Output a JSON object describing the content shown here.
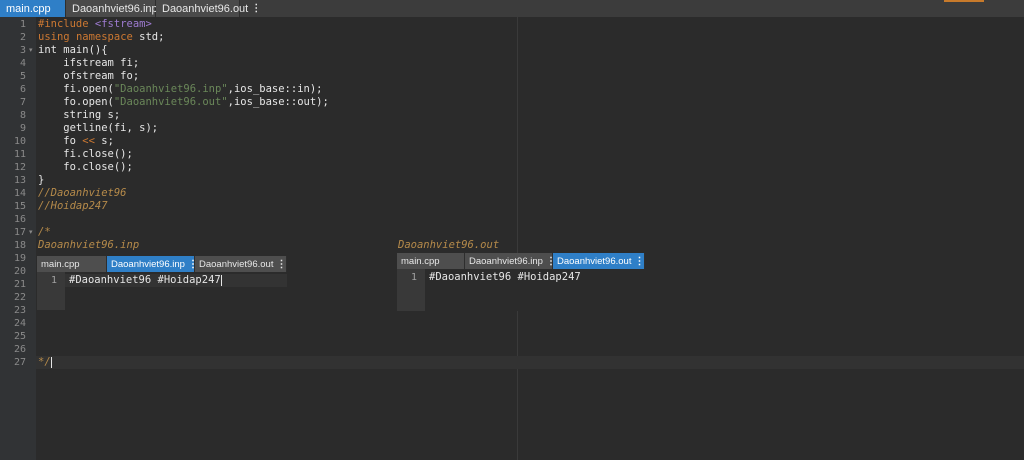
{
  "tabs": [
    {
      "label": "main.cpp",
      "active": true
    },
    {
      "label": "Daoanhviet96.inp",
      "active": false,
      "menu": "⋮"
    },
    {
      "label": "Daoanhviet96.out",
      "active": false,
      "menu": "⋮"
    }
  ],
  "line_numbers": [
    "1",
    "2",
    "3",
    "4",
    "5",
    "6",
    "7",
    "8",
    "9",
    "10",
    "11",
    "12",
    "13",
    "14",
    "15",
    "16",
    "17",
    "18",
    "19",
    "20",
    "21",
    "22",
    "23",
    "24",
    "25",
    "26",
    "27"
  ],
  "code": {
    "l1": {
      "kw": "#include",
      "str": "<fstream>"
    },
    "l2": {
      "kw1": "using",
      "kw2": "namespace",
      "rest": " std;"
    },
    "l3": "int main(){",
    "l4": "    ifstream fi;",
    "l5": "    ofstream fo;",
    "l6": {
      "pre": "    fi.open(",
      "str": "\"Daoanhviet96.inp\"",
      "post": ",ios_base::in);"
    },
    "l7": {
      "pre": "    fo.open(",
      "str": "\"Daoanhviet96.out\"",
      "post": ",ios_base::out);"
    },
    "l8": "    string s;",
    "l9": "    getline(fi, s);",
    "l10": {
      "pre": "    fo ",
      "op": "<<",
      "post": " s;"
    },
    "l11": "    fi.close();",
    "l12": "    fo.close();",
    "l13": "}",
    "l14": "//Daoanhviet96",
    "l15": "//Hoidap247",
    "l17": "/*",
    "l18a": "Daoanhviet96.inp",
    "l18b": "Daoanhviet96.out",
    "l27": "*/"
  },
  "mini_inp": {
    "tabs": [
      {
        "label": "main.cpp"
      },
      {
        "label": "Daoanhviet96.inp",
        "menu": "⋮"
      },
      {
        "label": "Daoanhviet96.out",
        "menu": "⋮"
      }
    ],
    "line_number": "1",
    "content": "#Daoanhviet96 #Hoidap247"
  },
  "mini_out": {
    "tabs": [
      {
        "label": "main.cpp"
      },
      {
        "label": "Daoanhviet96.inp",
        "menu": "⋮"
      },
      {
        "label": "Daoanhviet96.out",
        "menu": "⋮"
      }
    ],
    "line_number": "1",
    "content": "#Daoanhviet96 #Hoidap247"
  },
  "colors": {
    "background": "#2b2b2b",
    "active_tab": "#2f7fc7",
    "keyword": "#cc7832",
    "string": "#6a8759",
    "comment": "#b58a4a"
  }
}
